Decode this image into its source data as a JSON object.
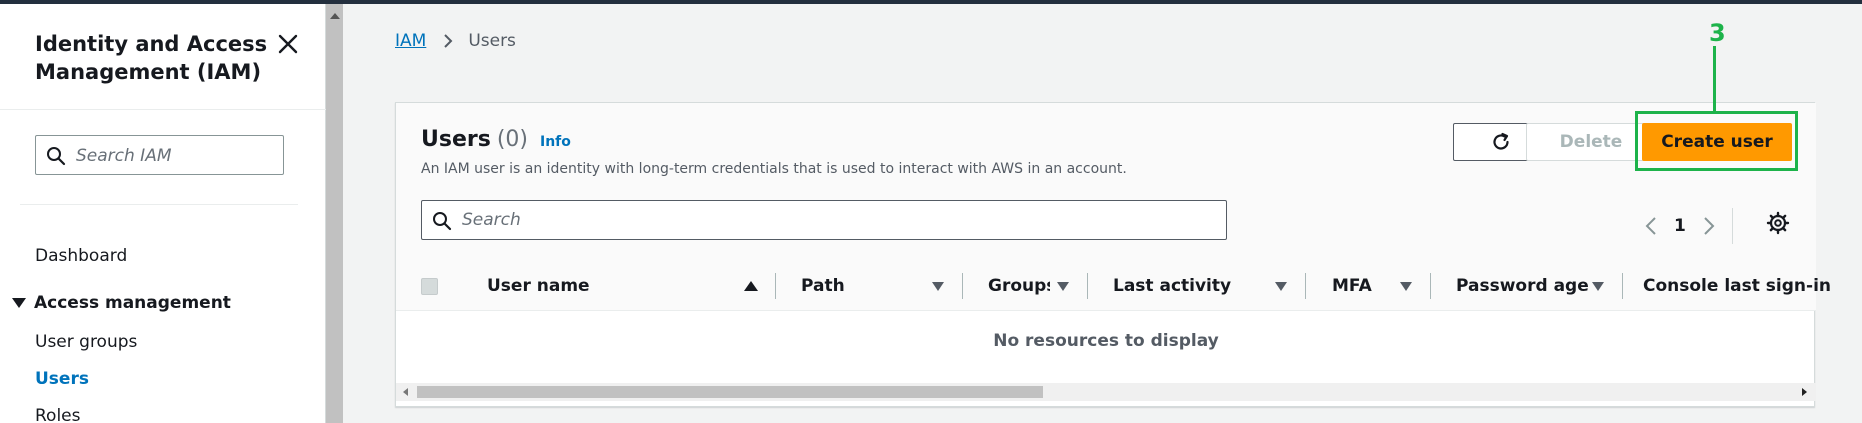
{
  "sidebar": {
    "title": "Identity and Access Management (IAM)",
    "search_placeholder": "Search IAM",
    "dashboard": "Dashboard",
    "section": "Access management",
    "items": [
      "User groups",
      "Users",
      "Roles"
    ],
    "active_item": "Users"
  },
  "breadcrumb": {
    "root": "IAM",
    "current": "Users"
  },
  "annotation": {
    "label": "3",
    "color": "#1db34a"
  },
  "panel": {
    "title": "Users",
    "count": "(0)",
    "info": "Info",
    "description": "An IAM user is an identity with long-term credentials that is used to interact with AWS in an account.",
    "delete_label": "Delete",
    "create_label": "Create user",
    "search_placeholder": "Search",
    "page": "1"
  },
  "table": {
    "columns": [
      "User name",
      "Path",
      "Groups",
      "Last activity",
      "MFA",
      "Password age",
      "Console last sign-in"
    ],
    "empty_text": "No resources to display"
  },
  "colors": {
    "accent": "#0073bb",
    "primary_button": "#ff9900",
    "nav_bar": "#232f3e"
  }
}
